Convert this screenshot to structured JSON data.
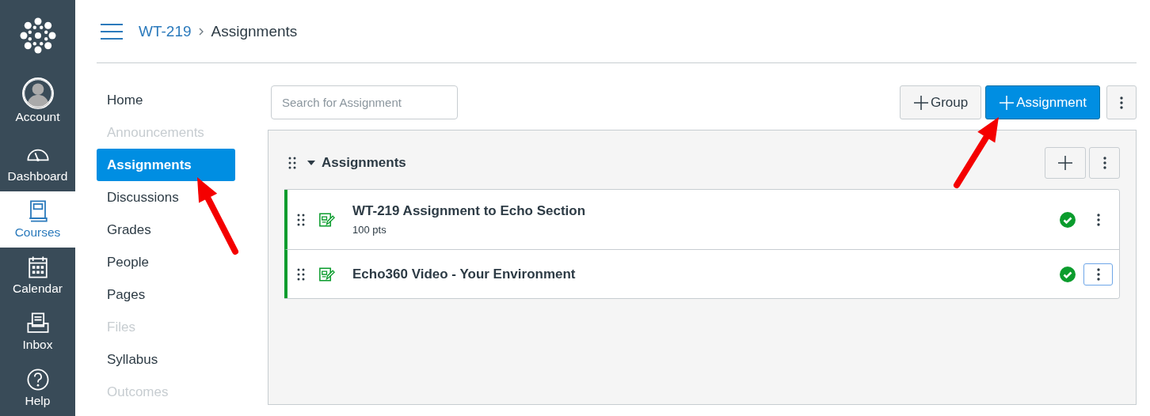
{
  "global_nav": [
    {
      "label": "Account",
      "selected": false
    },
    {
      "label": "Dashboard",
      "selected": false
    },
    {
      "label": "Courses",
      "selected": true
    },
    {
      "label": "Calendar",
      "selected": false
    },
    {
      "label": "Inbox",
      "selected": false
    },
    {
      "label": "Help",
      "selected": false
    }
  ],
  "breadcrumb": [
    "WT-219",
    "Assignments"
  ],
  "course_nav": [
    {
      "label": "Home",
      "disabled": false,
      "selected": false
    },
    {
      "label": "Announcements",
      "disabled": true,
      "selected": false
    },
    {
      "label": "Assignments",
      "disabled": false,
      "selected": true
    },
    {
      "label": "Discussions",
      "disabled": false,
      "selected": false
    },
    {
      "label": "Grades",
      "disabled": false,
      "selected": false
    },
    {
      "label": "People",
      "disabled": false,
      "selected": false
    },
    {
      "label": "Pages",
      "disabled": false,
      "selected": false
    },
    {
      "label": "Files",
      "disabled": true,
      "selected": false
    },
    {
      "label": "Syllabus",
      "disabled": false,
      "selected": false
    },
    {
      "label": "Outcomes",
      "disabled": true,
      "selected": false
    }
  ],
  "search": {
    "placeholder": "Search for Assignment"
  },
  "toolbar_buttons": [
    {
      "label": "Group",
      "primary": false
    },
    {
      "label": "Assignment",
      "primary": true
    }
  ],
  "group": {
    "title": "Assignments",
    "expanded": true,
    "assignments": [
      {
        "title": "WT-219 Assignment to Echo Section",
        "points": "100 pts",
        "published": true,
        "menu_focused": false
      },
      {
        "title": "Echo360 Video - Your Environment",
        "published": true,
        "menu_focused": true
      }
    ]
  },
  "annotations": [
    {
      "kind": "arrow"
    },
    {
      "kind": "arrow"
    }
  ]
}
